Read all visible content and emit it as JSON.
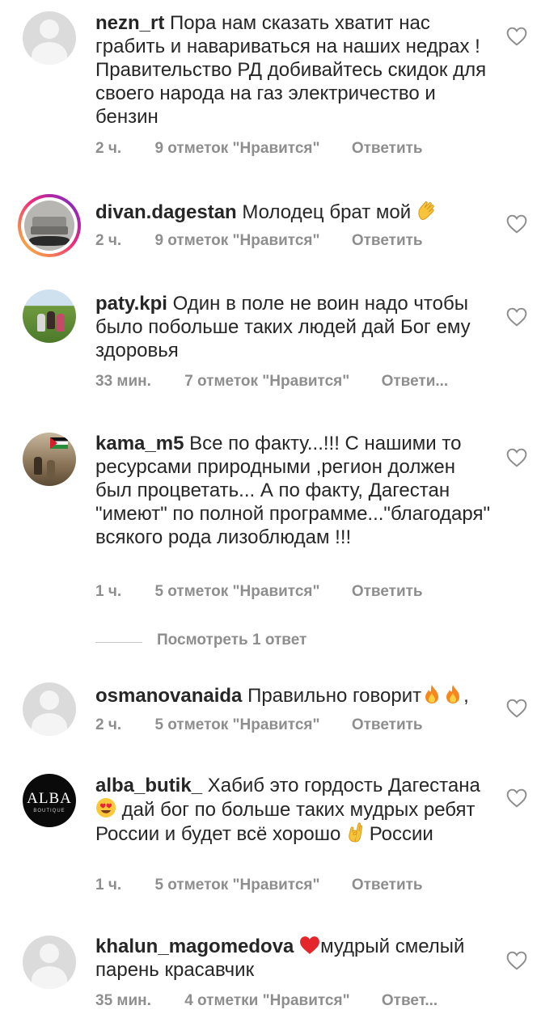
{
  "comments": [
    {
      "username": "nezn_rt",
      "text": "Пора нам сказать хватит нас грабить и навариваться на наших недрах ! Правительство РД добивайтесь скидок для своего народа на газ электричество и бензин",
      "time": "2 ч.",
      "likes": "9 отметок \"Нравится\"",
      "reply": "Ответить",
      "avatar": "default-avatar-icon"
    },
    {
      "username": "divan.dagestan",
      "text": "Молодец брат мой",
      "emoji": "clapping-hands-emoji",
      "time": "2 ч.",
      "likes": "9 отметок \"Нравится\"",
      "reply": "Ответить",
      "avatar": "sofa-photo"
    },
    {
      "username": "paty.kpi",
      "text": "Один в поле не воин надо чтобы было побольше таких людей дай Бог ему здоровья",
      "time": "33 мин.",
      "likes": "7 отметок \"Нравится\"",
      "reply": "Ответи...",
      "avatar": "meadow-photo"
    },
    {
      "username": "kama_m5",
      "text": "Все по факту...!!! С нашими то ресурсами природными ,регион должен был процветать... А по факту, Дагестан \"имеют\" по полной программе...\"благодаря\" всякого рода лизоблюдам !!!",
      "time": "1 ч.",
      "likes": "5 отметок \"Нравится\"",
      "reply": "Ответить",
      "avatar": "flag-photo"
    },
    {
      "username": "osmanovanaida",
      "text": "Правильно говорит",
      "text_suffix": ",",
      "emoji": "fire-emoji x2",
      "time": "2 ч.",
      "likes": "5 отметок \"Нравится\"",
      "reply": "Ответить",
      "avatar": "default-avatar-icon"
    },
    {
      "username": "alba_butik_",
      "text_a": "Хабиб это гордость Дагестана",
      "text_b": "дай бог по больше таких мудрых ребят России  и будет всё хорошо",
      "text_c": "России",
      "emoji": "heart-eyes-emoji, ok-hand-emoji",
      "time": "1 ч.",
      "likes": "5 отметок \"Нравится\"",
      "reply": "Ответить",
      "avatar": "alba-logo",
      "avatar_logo": "ALBA",
      "avatar_logo_sub": "BOUTIQUE"
    },
    {
      "username": "khalun_magomedova",
      "text": "мудрый смелый парень красавчик",
      "emoji": "red-heart-emoji",
      "time": "35 мин.",
      "likes": "4 отметки \"Нравится\"",
      "reply": "Ответ...",
      "avatar": "default-avatar-icon"
    }
  ],
  "view_replies": "Посмотреть 1 ответ",
  "colors": {
    "text": "#262626",
    "meta": "#8e8e8e",
    "line": "#c7c7c7"
  }
}
